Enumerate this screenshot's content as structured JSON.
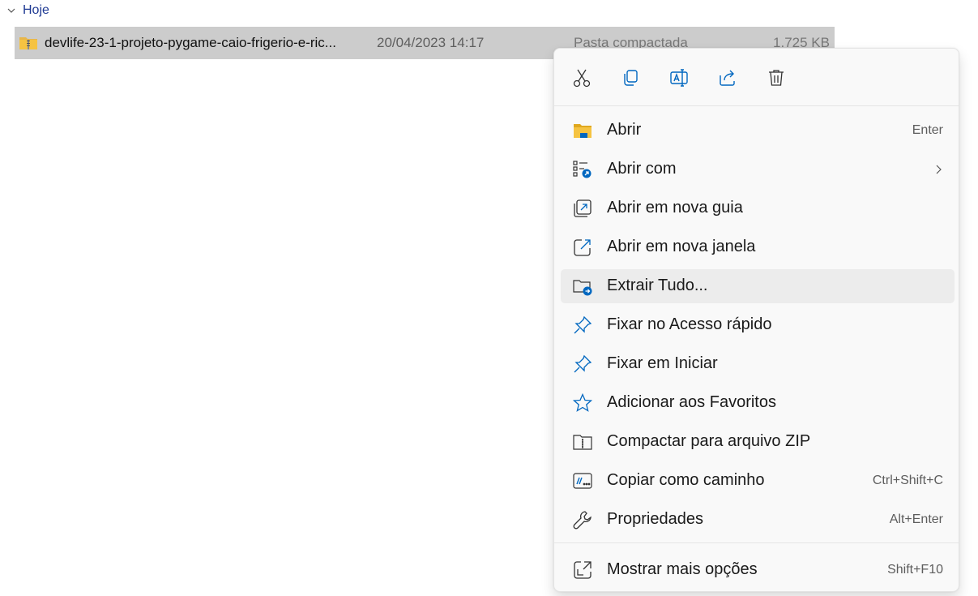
{
  "group": {
    "label": "Hoje"
  },
  "file": {
    "name": "devlife-23-1-projeto-pygame-caio-frigerio-e-ric...",
    "date": "20/04/2023 14:17",
    "type": "Pasta compactada",
    "size": "1.725 KB"
  },
  "quick_actions": [
    {
      "icon": "cut-icon"
    },
    {
      "icon": "copy-icon"
    },
    {
      "icon": "rename-icon"
    },
    {
      "icon": "share-icon"
    },
    {
      "icon": "delete-icon"
    }
  ],
  "items": [
    {
      "label": "Abrir",
      "shortcut": "Enter",
      "icon": "folder-open-icon"
    },
    {
      "label": "Abrir com",
      "shortcut": "",
      "icon": "open-with-icon",
      "submenu": true
    },
    {
      "label": "Abrir em nova guia",
      "shortcut": "",
      "icon": "new-tab-icon"
    },
    {
      "label": "Abrir em nova janela",
      "shortcut": "",
      "icon": "new-window-icon"
    },
    {
      "label": "Extrair Tudo...",
      "shortcut": "",
      "icon": "extract-icon",
      "highlighted": true
    },
    {
      "label": "Fixar no Acesso rápido",
      "shortcut": "",
      "icon": "pin-icon"
    },
    {
      "label": "Fixar em Iniciar",
      "shortcut": "",
      "icon": "pin-start-icon"
    },
    {
      "label": "Adicionar aos Favoritos",
      "shortcut": "",
      "icon": "star-icon"
    },
    {
      "label": "Compactar para arquivo ZIP",
      "shortcut": "",
      "icon": "zip-icon"
    },
    {
      "label": "Copiar como caminho",
      "shortcut": "Ctrl+Shift+C",
      "icon": "copy-path-icon"
    },
    {
      "label": "Propriedades",
      "shortcut": "Alt+Enter",
      "icon": "wrench-icon"
    },
    {
      "label": "Mostrar mais opções",
      "shortcut": "Shift+F10",
      "icon": "more-options-icon"
    }
  ],
  "colors": {
    "accent": "#0067c0",
    "selection": "#cccccc",
    "hover": "#ececec",
    "folder": "#f5c342"
  }
}
